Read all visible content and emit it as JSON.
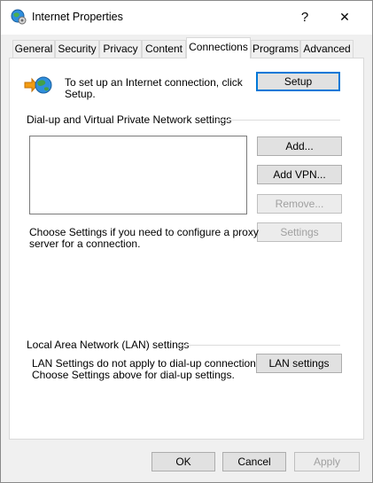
{
  "window": {
    "title": "Internet Properties",
    "help_label": "?",
    "close_label": "✕",
    "icon": "globe-settings-icon"
  },
  "tabs": [
    {
      "label": "General"
    },
    {
      "label": "Security"
    },
    {
      "label": "Privacy"
    },
    {
      "label": "Content"
    },
    {
      "label": "Connections"
    },
    {
      "label": "Programs"
    },
    {
      "label": "Advanced"
    }
  ],
  "active_tab": "Connections",
  "setup": {
    "line1": "To set up an Internet connection, click",
    "line2": "Setup.",
    "button": "Setup",
    "icon": "network-globe-icon"
  },
  "dialup": {
    "heading": "Dial-up and Virtual Private Network settings",
    "add_button": "Add...",
    "add_vpn_button": "Add VPN...",
    "remove_button": "Remove...",
    "settings_button": "Settings",
    "proxy_line1": "Choose Settings if you need to configure a proxy",
    "proxy_line2": "server for a connection."
  },
  "lan": {
    "heading": "Local Area Network (LAN) settings",
    "line1": "LAN Settings do not apply to dial-up connections.",
    "line2": "Choose Settings above for dial-up settings.",
    "button": "LAN settings"
  },
  "footer": {
    "ok": "OK",
    "cancel": "Cancel",
    "apply": "Apply"
  }
}
